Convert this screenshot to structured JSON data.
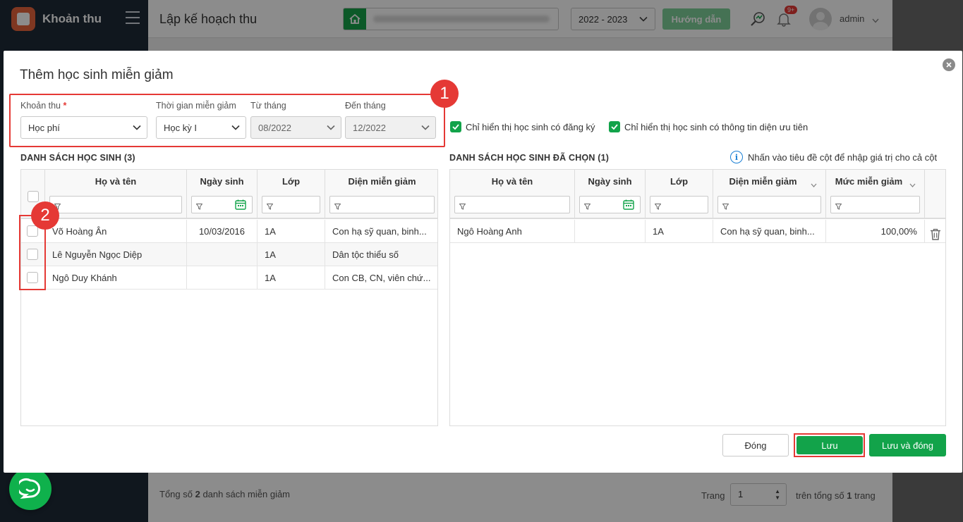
{
  "app": {
    "brand": "Khoản thu",
    "page_title": "Lập kế hoạch thu",
    "year": "2022 - 2023",
    "help_label": "Hướng dẫn",
    "notif_badge": "9+",
    "username": "admin"
  },
  "footer": {
    "total_prefix": "Tổng số ",
    "total_count": "2",
    "total_suffix": " danh sách miễn giảm",
    "page_label": "Trang",
    "page_value": "1",
    "of_prefix": "trên tổng số ",
    "of_count": "1",
    "of_suffix": " trang"
  },
  "modal": {
    "title": "Thêm học sinh miễn giảm",
    "markers": [
      "1",
      "2"
    ],
    "filters": {
      "khoan_thu_label": "Khoản thu",
      "required_mark": "*",
      "khoan_thu_value": "Học phí",
      "thoi_gian_label": "Thời gian miễn giảm",
      "thoi_gian_value": "Học kỳ I",
      "tu_thang_label": "Từ tháng",
      "tu_thang_value": "08/2022",
      "den_thang_label": "Đến tháng",
      "den_thang_value": "12/2022"
    },
    "checkboxes": {
      "registered_only": "Chỉ hiển thị học sinh có đăng ký",
      "priority_only": "Chỉ hiển thị học sinh có thông tin diện ưu tiên"
    },
    "left_grid": {
      "title": "DANH SÁCH HỌC SINH (3)",
      "columns": [
        "Họ và tên",
        "Ngày sinh",
        "Lớp",
        "Diện miễn giảm"
      ],
      "rows": [
        {
          "name": "Võ Hoàng Ân",
          "dob": "10/03/2016",
          "class": "1A",
          "category": "Con hạ sỹ quan, binh..."
        },
        {
          "name": "Lê Nguyễn Ngọc Diệp",
          "dob": "",
          "class": "1A",
          "category": "Dân tộc thiểu số"
        },
        {
          "name": "Ngô Duy Khánh",
          "dob": "",
          "class": "1A",
          "category": "Con CB, CN, viên chứ..."
        }
      ]
    },
    "right_grid": {
      "title": "DANH SÁCH HỌC SINH ĐÃ CHỌN (1)",
      "hint": "Nhấn vào tiêu đề cột để nhập giá trị cho cả cột",
      "columns": [
        "Họ và tên",
        "Ngày sinh",
        "Lớp",
        "Diện miễn giảm",
        "Mức miễn giảm"
      ],
      "rows": [
        {
          "name": "Ngô Hoàng Anh",
          "dob": "",
          "class": "1A",
          "category": "Con hạ sỹ quan, binh...",
          "rate": "100,00%"
        }
      ]
    },
    "buttons": {
      "close": "Đóng",
      "save": "Lưu",
      "save_close": "Lưu và đóng"
    }
  },
  "colors": {
    "accent_green": "#12a34a",
    "annotation_red": "#e53935",
    "sidebar": "#1e2a38"
  }
}
